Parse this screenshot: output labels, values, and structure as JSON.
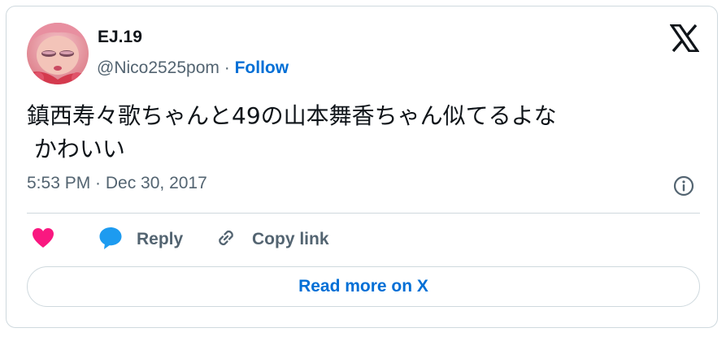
{
  "author": {
    "name": "EJ.19",
    "handle": "@Nico2525pom",
    "separator": "·",
    "follow_label": "Follow"
  },
  "tweet": {
    "text": "鎮西寿々歌ちゃんと49の山本舞香ちゃん似てるよな\n かわいい",
    "timestamp": "5:53 PM · Dec 30, 2017"
  },
  "actions": {
    "reply_label": "Reply",
    "copy_link_label": "Copy link"
  },
  "footer": {
    "read_more_label": "Read more on X"
  },
  "icons": {
    "brand": "x-logo-icon",
    "info": "info-icon",
    "like": "heart-icon",
    "reply": "speech-bubble-icon",
    "copy_link": "link-icon"
  },
  "colors": {
    "link": "#006fd6",
    "like": "#f91880",
    "reply": "#1d9bf0",
    "secondary_text": "#536471",
    "border": "#cfd9de"
  }
}
